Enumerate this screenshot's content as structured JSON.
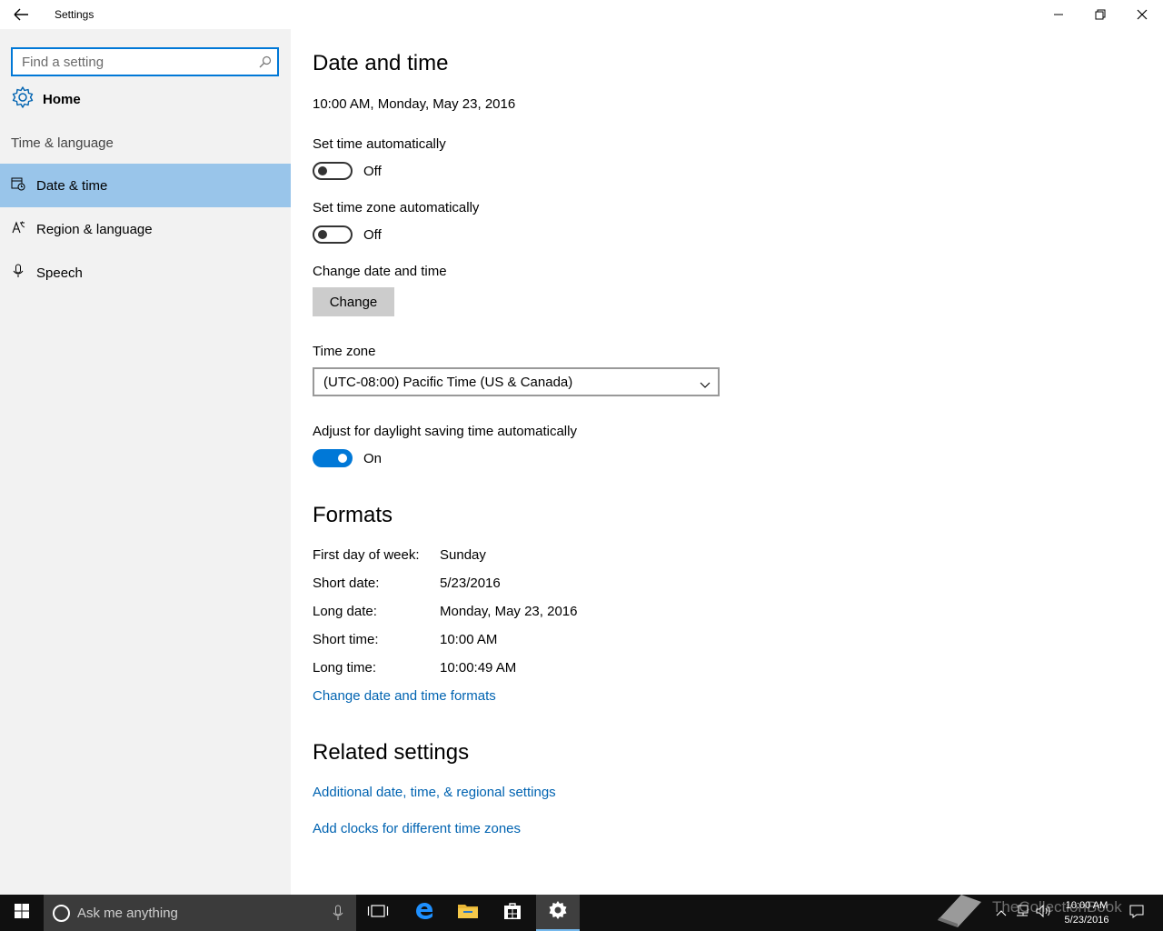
{
  "window": {
    "title": "Settings"
  },
  "sidebar": {
    "search_placeholder": "Find a setting",
    "home_label": "Home",
    "section_label": "Time & language",
    "items": [
      {
        "label": "Date & time",
        "icon": "calendar-clock-icon",
        "active": true
      },
      {
        "label": "Region & language",
        "icon": "language-icon",
        "active": false
      },
      {
        "label": "Speech",
        "icon": "microphone-icon",
        "active": false
      }
    ]
  },
  "main": {
    "title": "Date and time",
    "current_datetime": "10:00 AM, Monday, May 23, 2016",
    "set_time_auto": {
      "label": "Set time automatically",
      "state": "Off",
      "on": false
    },
    "set_tz_auto": {
      "label": "Set time zone automatically",
      "state": "Off",
      "on": false
    },
    "change_section": {
      "label": "Change date and time",
      "button": "Change"
    },
    "timezone": {
      "label": "Time zone",
      "value": "(UTC-08:00) Pacific Time (US & Canada)"
    },
    "dst": {
      "label": "Adjust for daylight saving time automatically",
      "state": "On",
      "on": true
    },
    "formats": {
      "title": "Formats",
      "rows": [
        {
          "key": "First day of week:",
          "value": "Sunday"
        },
        {
          "key": "Short date:",
          "value": "5/23/2016"
        },
        {
          "key": "Long date:",
          "value": "Monday, May 23, 2016"
        },
        {
          "key": "Short time:",
          "value": "10:00 AM"
        },
        {
          "key": "Long time:",
          "value": "10:00:49 AM"
        }
      ],
      "link": "Change date and time formats"
    },
    "related": {
      "title": "Related settings",
      "links": [
        "Additional date, time, & regional settings",
        "Add clocks for different time zones"
      ]
    }
  },
  "taskbar": {
    "search_placeholder": "Ask me anything",
    "watermark": "TheCollectionBook",
    "clock_time": "10:00 AM",
    "clock_date": "5/23/2016"
  },
  "colors": {
    "accent": "#0078d7",
    "nav_active": "#99c5ea",
    "link": "#0063b1",
    "taskbar": "#101010"
  }
}
